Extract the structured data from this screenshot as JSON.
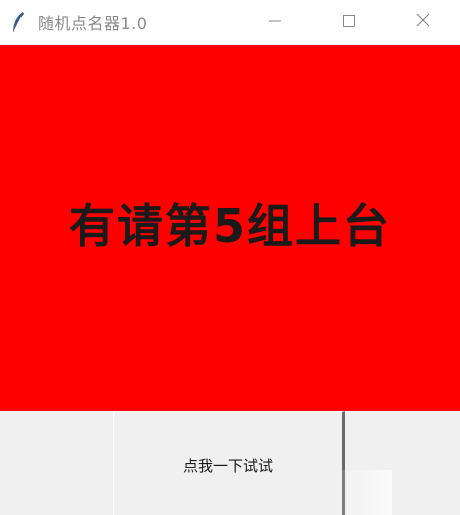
{
  "window": {
    "title": "随机点名器1.0",
    "app_icon": "feather-icon",
    "controls": {
      "minimize_icon": "minimize-icon",
      "maximize_icon": "maximize-icon",
      "close_icon": "close-icon"
    }
  },
  "main": {
    "banner_text": "有请第5组上台",
    "banner_color": "#ff0000"
  },
  "action": {
    "button_label": "点我一下试试"
  }
}
